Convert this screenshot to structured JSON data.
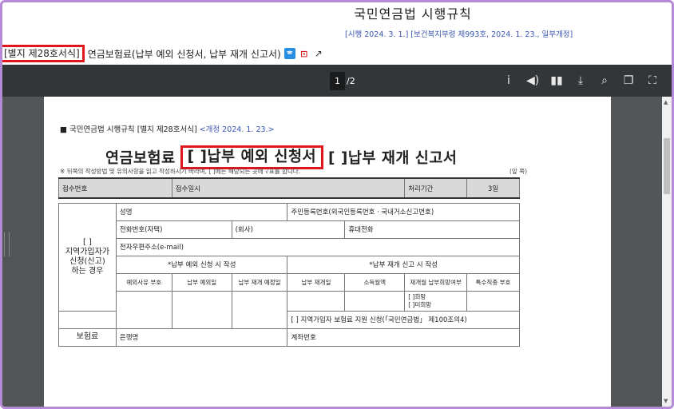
{
  "header": {
    "law_title": "국민연금법 시행규칙",
    "law_subtitle": "[시행 2024. 3. 1.] [보건복지부령 제993호, 2024. 1. 23., 일부개정]",
    "form_number": "[별지 제28호서식]",
    "form_name": "연금보험료(납부 예외 신청서, 납부 재개 신고서)",
    "icons": [
      "hwp-download-icon",
      "pdf-download-icon",
      "share-icon"
    ]
  },
  "viewer": {
    "page_current": "1",
    "page_total": "/2",
    "toolbar_icons": [
      "info-icon",
      "speaker-icon",
      "menu-icon",
      "download-icon",
      "search-icon",
      "copy-icon",
      "fullscreen-icon"
    ]
  },
  "document": {
    "rule_line": "■ 국민연금법 시행규칙 [별지 제28호서식]",
    "revision": "<개정 2024. 1. 23.>",
    "title_prefix": "연금보험료",
    "title_boxed": "[ ]납부 예외 신청서",
    "title_suffix": "[ ]납부 재개 신고서",
    "note": "※ 뒤쪽의 작성방법 및 유의사항을 읽고 작성하시기 바라며, [ ]에는 해당되는 곳에 √표를 합니다.",
    "note_right": "(앞 쪽)",
    "receipt": {
      "no": "접수번호",
      "date": "접수일시",
      "period_label": "처리기간",
      "period_value": "3일"
    },
    "section": "[ ]\n지역가입자가\n신청(신고)\n하는 경우",
    "fields": {
      "name": "성명",
      "resident_no": "주민등록번호(외국인등록번호ㆍ국내거소신고번호)",
      "phone_home": "전화번호(자택)",
      "phone_office": "(회사)",
      "mobile": "휴대전화",
      "email": "전자우편주소(e-mail)",
      "exception_head": "*납부 예외 신청 시 작성",
      "resume_head": "*납부 재개 신고 시 작성",
      "col_reason": "예외사유 부호",
      "col_exc_date": "납부 예외일",
      "col_resume_plan": "납부 재개 예정일",
      "col_resume_date": "납부 재개일",
      "col_income": "소득월액",
      "col_wish": "재개월 납부희망여부",
      "col_special": "특수직종 부호",
      "opt_yes": "[ ]희망",
      "opt_no": "[ ]미희망",
      "support": "[ ] 지역가입자 보험료 지원 신청(「국민연금법」 제100조의4)",
      "bank": "은행명",
      "account": "계좌번호",
      "bottom_section": "보험료"
    }
  }
}
